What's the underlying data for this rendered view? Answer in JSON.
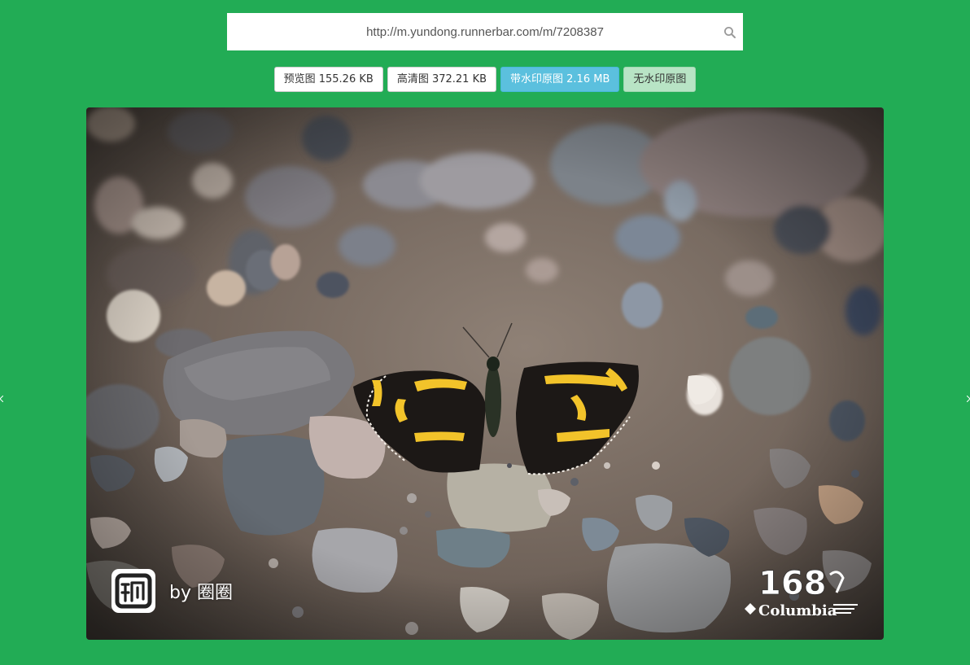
{
  "search": {
    "url": "http://m.yundong.runnerbar.com/m/7208387",
    "icon": "search-icon"
  },
  "buttons": [
    {
      "label": "预览图 155.26 KB",
      "style": "default"
    },
    {
      "label": "高清图 372.21 KB",
      "style": "default"
    },
    {
      "label": "带水印原图 2.16 MB",
      "style": "info"
    },
    {
      "label": "无水印原图",
      "style": "success-light"
    }
  ],
  "photo": {
    "watermark_author": "by 圈圈",
    "app_logo": "dong-app-logo",
    "race_logo": "168 Columbia ultra trail logo",
    "race_logo_number": "168",
    "race_logo_brand": "Columbia"
  },
  "colors": {
    "page_background": "#22ac55",
    "info_button": "#5bc0de",
    "success_light_button": "#b8e4c5"
  }
}
